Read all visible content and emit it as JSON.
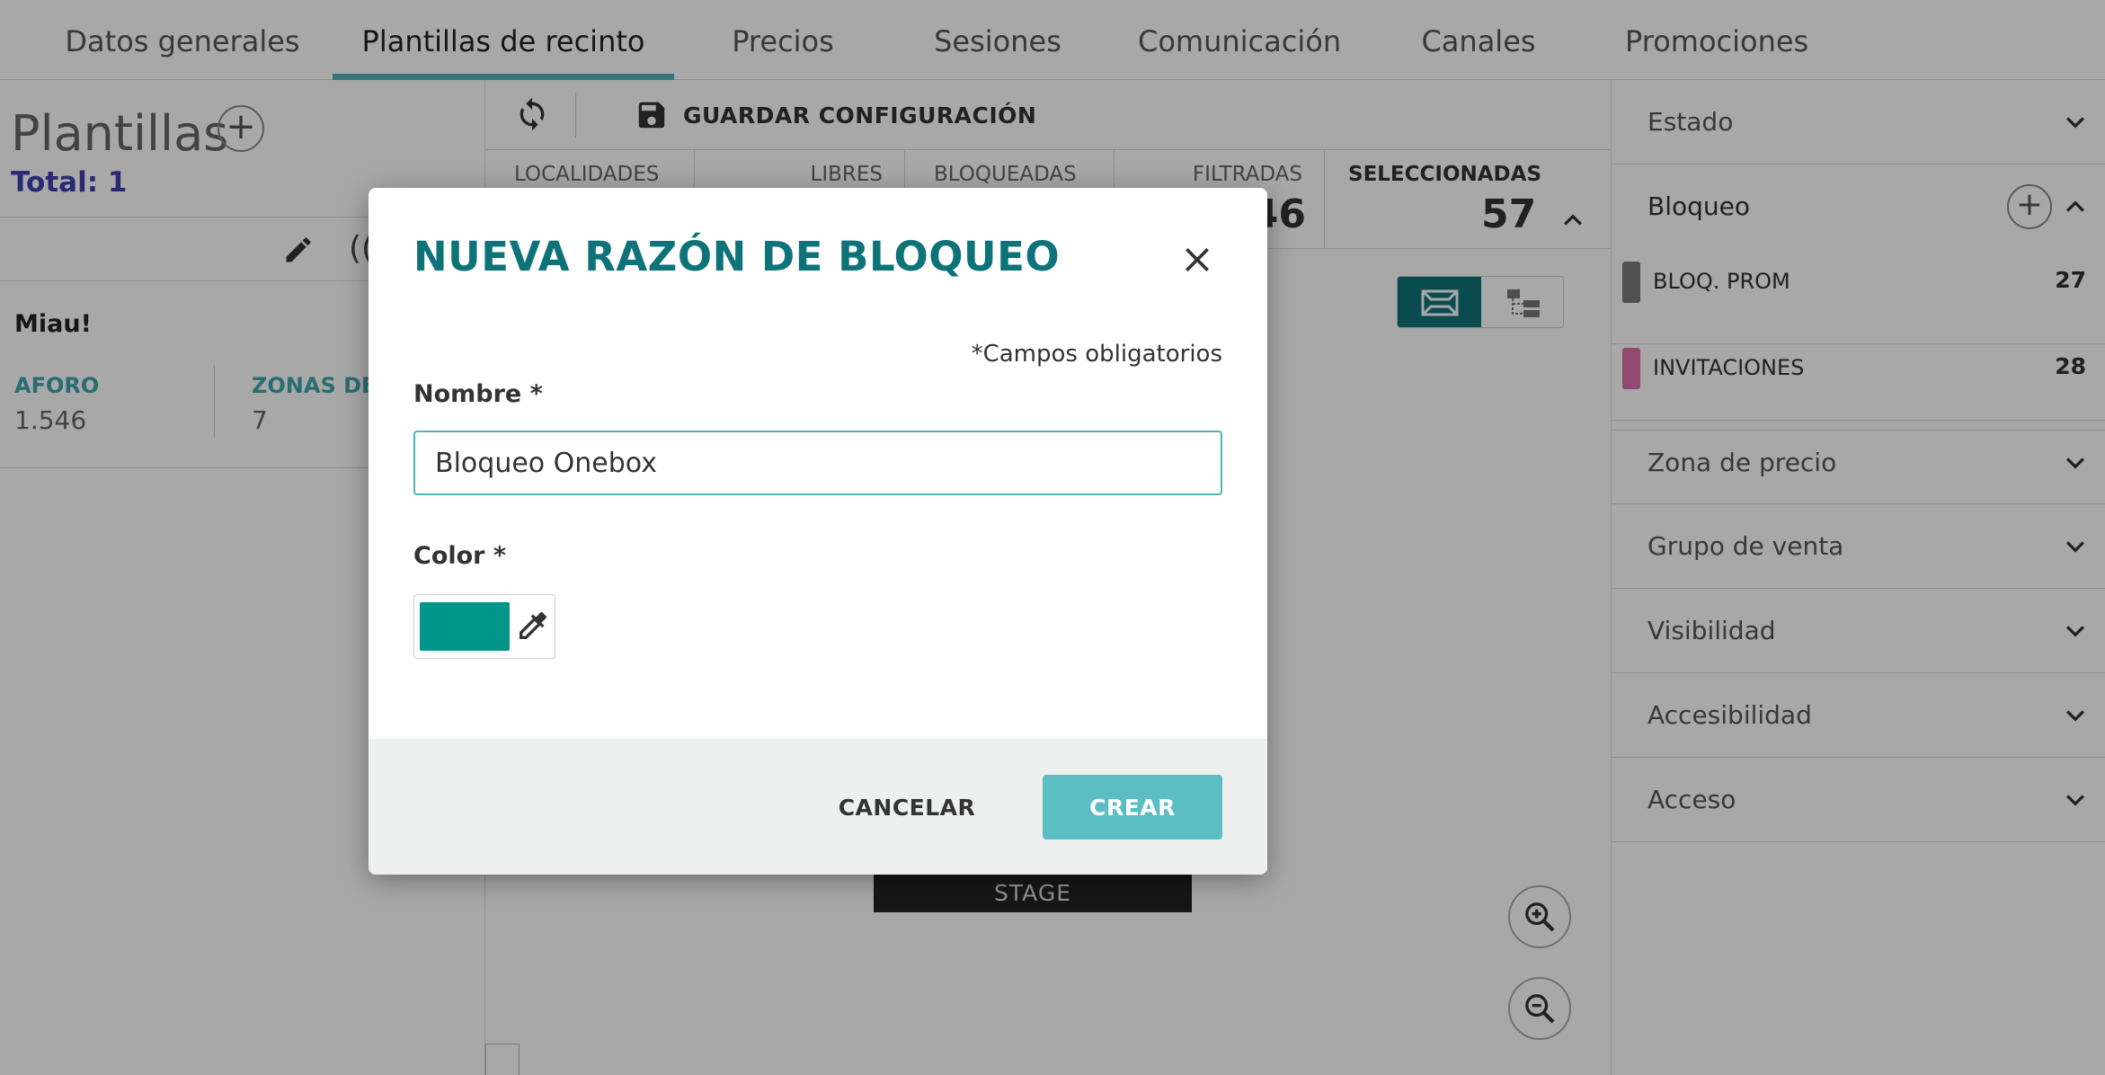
{
  "tabs": [
    {
      "label": "Datos generales"
    },
    {
      "label": "Plantillas de recinto"
    },
    {
      "label": "Precios"
    },
    {
      "label": "Sesiones"
    },
    {
      "label": "Comunicación"
    },
    {
      "label": "Canales"
    },
    {
      "label": "Promociones"
    }
  ],
  "active_tab": "Plantillas de recinto",
  "left_panel": {
    "title": "Plantillas",
    "add_symbol": "+",
    "total": "Total: 1",
    "other_icon_glyph": "((",
    "card": {
      "name": "Miau!",
      "stats": [
        {
          "label": "AFORO",
          "value": "1.546"
        },
        {
          "label": "ZONAS DE",
          "value": "7"
        }
      ]
    }
  },
  "toolbar": {
    "save_label": "GUARDAR CONFIGURACIÓN"
  },
  "counts": [
    {
      "label": "LOCALIDADES",
      "value": ""
    },
    {
      "label": "LIBRES",
      "value": ""
    },
    {
      "label": "BLOQUEADAS",
      "value": ""
    },
    {
      "label": "FILTRADAS",
      "value": "46"
    },
    {
      "label": "SELECCIONADAS",
      "value": "57"
    }
  ],
  "stage_label": "STAGE",
  "right_panel": {
    "sections": [
      {
        "title": "Estado"
      },
      {
        "title": "Bloqueo"
      },
      {
        "title": "Zona de precio"
      },
      {
        "title": "Grupo de venta"
      },
      {
        "title": "Visibilidad"
      },
      {
        "title": "Accesibilidad"
      },
      {
        "title": "Acceso"
      }
    ],
    "block_add_symbol": "+",
    "block_items": [
      {
        "name": "BLOQ. PROM",
        "count": "27",
        "color": "#7a7a7a"
      },
      {
        "name": "INVITACIONES",
        "count": "28",
        "color": "#e06fa8"
      }
    ]
  },
  "modal": {
    "title": "NUEVA RAZÓN DE BLOQUEO",
    "required_note": "*Campos obligatorios",
    "name_label": "Nombre *",
    "name_value": "Bloqueo Onebox",
    "color_label": "Color *",
    "color_value": "#00978a",
    "cancel_label": "CANCELAR",
    "create_label": "CREAR"
  },
  "colors": {
    "accent": "#4fb3b8",
    "title_teal": "#0e7378",
    "create_button": "#5bbec3",
    "total_text": "#3f3fb0"
  }
}
